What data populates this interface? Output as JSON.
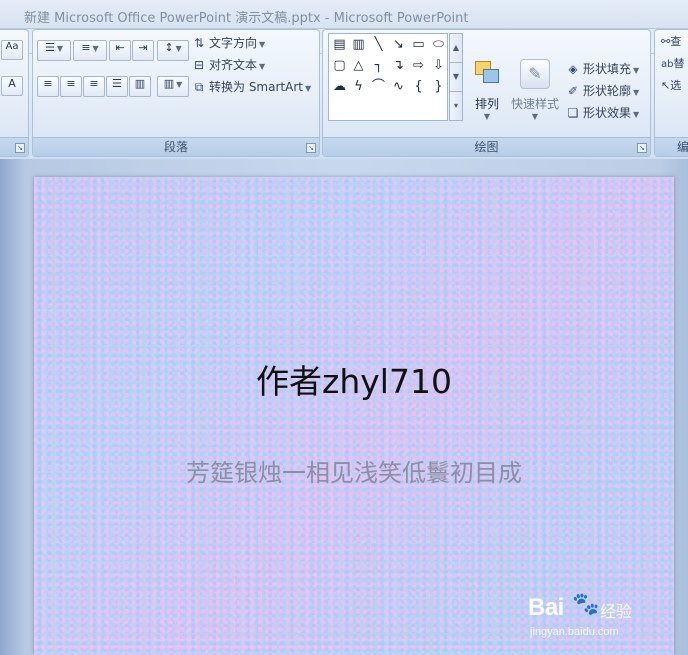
{
  "window": {
    "title": "新建 Microsoft Office PowerPoint 演示文稿.pptx - Microsoft PowerPoint"
  },
  "ribbon": {
    "paragraph_group": {
      "label": "段落",
      "text_direction": "文字方向",
      "align_text": "对齐文本",
      "convert_smartart": "转换为 SmartArt"
    },
    "drawing_group": {
      "label": "绘图",
      "arrange": "排列",
      "quick_styles": "快速样式",
      "shape_fill": "形状填充",
      "shape_outline": "形状轮廓",
      "shape_effects": "形状效果"
    },
    "editing_group": {
      "label": "编",
      "find": "查",
      "replace": "替",
      "select": "选"
    }
  },
  "slide": {
    "title": "作者zhyl710",
    "subtitle": "芳筵银烛一相见浅笑低鬟初目成"
  },
  "watermark": {
    "brand": "Bai",
    "brand_suffix": "经验",
    "url": "jingyan.baidu.com"
  }
}
